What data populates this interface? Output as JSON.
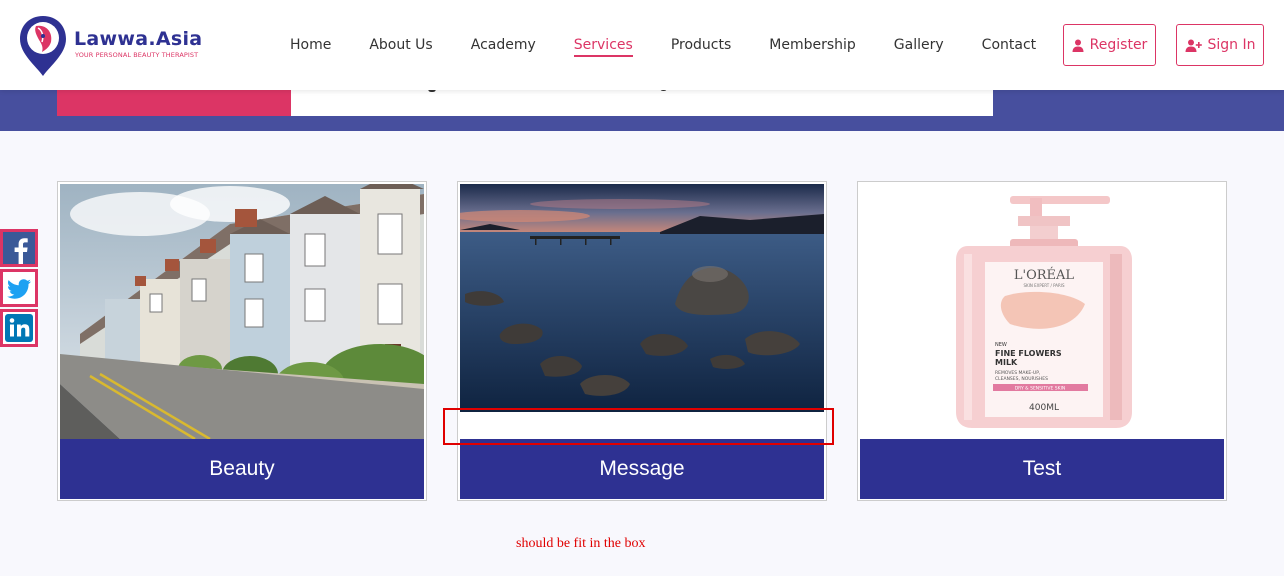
{
  "brand": {
    "name": "Lawwa.Asia",
    "tagline": "YOUR PERSONAL BEAUTY THERAPIST",
    "primary_color": "#2e3192",
    "accent_color": "#dc3565"
  },
  "nav": {
    "items": [
      {
        "label": "Home"
      },
      {
        "label": "About Us"
      },
      {
        "label": "Academy"
      },
      {
        "label": "Services",
        "active": true
      },
      {
        "label": "Products"
      },
      {
        "label": "Membership"
      },
      {
        "label": "Gallery"
      },
      {
        "label": "Contact"
      }
    ]
  },
  "auth": {
    "register_label": "Register",
    "register_icon": "user-icon",
    "signin_label": "Sign In",
    "signin_icon": "user-plus-icon"
  },
  "social": [
    {
      "name": "facebook-icon"
    },
    {
      "name": "twitter-icon"
    },
    {
      "name": "linkedin-icon"
    }
  ],
  "cards": [
    {
      "label": "Beauty",
      "image": "row of terraced houses on a street"
    },
    {
      "label": "Message",
      "image": "rocks in a calm lake at dusk with a pier"
    },
    {
      "label": "Test",
      "image": "L'Oreal Fine Flowers Milk bottle"
    }
  ],
  "product_label": {
    "brand": "L'ORÉAL",
    "sub": "SKIN EXPERT / PARIS",
    "new": "NEW",
    "line1": "FINE FLOWERS",
    "line2": "MILK",
    "desc1": "REMOVES MAKE-UP,",
    "desc2": "CLEANSES, NOURISHES",
    "badge": "DRY & SENSITIVE SKIN",
    "volume": "400ML"
  },
  "annotation": {
    "text": "should be fit in the box",
    "color": "#e00000"
  }
}
